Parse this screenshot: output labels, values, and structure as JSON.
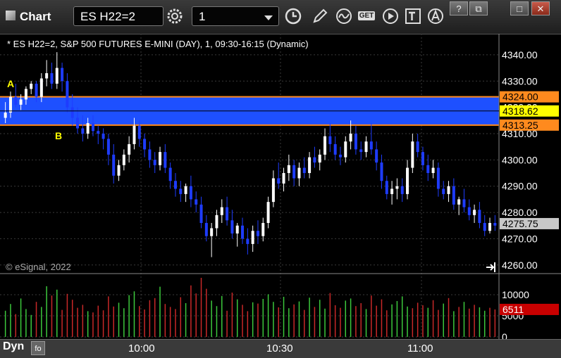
{
  "app": {
    "title": "Chart",
    "icon": "chart-window-icon"
  },
  "toolbar": {
    "symbol": "ES H22=2",
    "interval": "1",
    "buttons": [
      "settings-icon",
      "clock-icon",
      "pencil-icon",
      "wave-icon",
      "get-icon",
      "play-icon",
      "text-icon",
      "alert-icon"
    ],
    "get_label": "GET"
  },
  "window_buttons": {
    "help": "?",
    "restore": "⧉",
    "maximize": "□",
    "close": "✕"
  },
  "chart": {
    "title": "* ES H22=2, S&P 500 FUTURES E-MINI (DAY), 1, 09:30-16:15 (Dynamic)",
    "copyright": "© eSignal, 2022",
    "label_a": "A",
    "label_b": "B",
    "colors": {
      "up": "#ffffff",
      "down": "#1e3cff",
      "zone": "#1e50ff",
      "zone_line": "#ff8a1e",
      "last_price": "#c8c8c8",
      "mid_price": "#ffff00",
      "vol_up": "#3cc83c",
      "vol_down": "#c82828"
    }
  },
  "chart_data": {
    "type": "candlestick",
    "price_axis": {
      "ticks": [
        "4340.00",
        "4330.00",
        "4320.00",
        "4310.00",
        "4300.00",
        "4290.00",
        "4280.00",
        "4270.00",
        "4260.00"
      ],
      "range": [
        4257,
        4348
      ]
    },
    "price_labels": {
      "zone_top": "4324.00",
      "zone_mid": "4318.62",
      "zone_bottom": "4313.25",
      "last": "4275.75"
    },
    "zone": [
      4313.25,
      4324.0
    ],
    "volume_axis": {
      "ticks": [
        "10000",
        "5000",
        "0"
      ],
      "last_label": "6511",
      "range": [
        0,
        14500
      ]
    },
    "time_labels": [
      "10:00",
      "10:30",
      "11:00"
    ],
    "candles": [
      [
        4316,
        4322,
        4314,
        4318
      ],
      [
        4318,
        4326,
        4316,
        4324
      ],
      [
        4324,
        4329,
        4320,
        4321
      ],
      [
        4321,
        4325,
        4319,
        4323
      ],
      [
        4323,
        4328,
        4321,
        4327
      ],
      [
        4327,
        4330,
        4325,
        4329
      ],
      [
        4329,
        4330,
        4322,
        4324
      ],
      [
        4324,
        4333,
        4322,
        4331
      ],
      [
        4331,
        4338,
        4328,
        4333
      ],
      [
        4333,
        4337,
        4327,
        4329
      ],
      [
        4329,
        4341,
        4327,
        4335
      ],
      [
        4335,
        4337,
        4326,
        4330
      ],
      [
        4330,
        4333,
        4318,
        4320
      ],
      [
        4320,
        4325,
        4313,
        4316
      ],
      [
        4316,
        4320,
        4310,
        4312
      ],
      [
        4312,
        4317,
        4307,
        4310
      ],
      [
        4310,
        4316,
        4308,
        4314
      ],
      [
        4314,
        4317,
        4309,
        4311
      ],
      [
        4311,
        4313,
        4306,
        4310
      ],
      [
        4310,
        4312,
        4304,
        4308
      ],
      [
        4308,
        4310,
        4298,
        4302
      ],
      [
        4302,
        4306,
        4291,
        4294
      ],
      [
        4294,
        4300,
        4292,
        4298
      ],
      [
        4298,
        4304,
        4296,
        4302
      ],
      [
        4302,
        4309,
        4299,
        4306
      ],
      [
        4306,
        4316,
        4304,
        4313
      ],
      [
        4313,
        4315,
        4305,
        4308
      ],
      [
        4308,
        4310,
        4301,
        4304
      ],
      [
        4304,
        4307,
        4297,
        4300
      ],
      [
        4300,
        4303,
        4295,
        4298
      ],
      [
        4298,
        4305,
        4296,
        4303
      ],
      [
        4303,
        4306,
        4295,
        4297
      ],
      [
        4297,
        4299,
        4289,
        4292
      ],
      [
        4292,
        4295,
        4286,
        4289
      ],
      [
        4289,
        4292,
        4284,
        4287
      ],
      [
        4287,
        4291,
        4284,
        4290
      ],
      [
        4290,
        4294,
        4282,
        4285
      ],
      [
        4285,
        4288,
        4280,
        4283
      ],
      [
        4283,
        4286,
        4274,
        4276
      ],
      [
        4276,
        4279,
        4269,
        4271
      ],
      [
        4271,
        4276,
        4263,
        4274
      ],
      [
        4274,
        4281,
        4271,
        4279
      ],
      [
        4279,
        4285,
        4276,
        4282
      ],
      [
        4282,
        4286,
        4275,
        4277
      ],
      [
        4277,
        4281,
        4270,
        4272
      ],
      [
        4272,
        4276,
        4267,
        4275
      ],
      [
        4275,
        4278,
        4268,
        4270
      ],
      [
        4270,
        4274,
        4264,
        4268
      ],
      [
        4268,
        4275,
        4265,
        4273
      ],
      [
        4273,
        4277,
        4268,
        4271
      ],
      [
        4271,
        4278,
        4269,
        4276
      ],
      [
        4276,
        4286,
        4274,
        4284
      ],
      [
        4284,
        4296,
        4282,
        4293
      ],
      [
        4293,
        4299,
        4289,
        4291
      ],
      [
        4291,
        4297,
        4288,
        4295
      ],
      [
        4295,
        4302,
        4292,
        4298
      ],
      [
        4298,
        4300,
        4290,
        4293
      ],
      [
        4293,
        4299,
        4290,
        4297
      ],
      [
        4297,
        4301,
        4293,
        4295
      ],
      [
        4295,
        4303,
        4293,
        4301
      ],
      [
        4301,
        4305,
        4297,
        4299
      ],
      [
        4299,
        4304,
        4296,
        4302
      ],
      [
        4302,
        4312,
        4300,
        4309
      ],
      [
        4309,
        4314,
        4303,
        4306
      ],
      [
        4306,
        4309,
        4300,
        4302
      ],
      [
        4302,
        4305,
        4298,
        4301
      ],
      [
        4301,
        4309,
        4299,
        4307
      ],
      [
        4307,
        4315,
        4304,
        4310
      ],
      [
        4310,
        4313,
        4302,
        4304
      ],
      [
        4304,
        4307,
        4300,
        4303
      ],
      [
        4303,
        4309,
        4301,
        4307
      ],
      [
        4307,
        4314,
        4302,
        4304
      ],
      [
        4304,
        4307,
        4296,
        4299
      ],
      [
        4299,
        4302,
        4289,
        4292
      ],
      [
        4292,
        4294,
        4285,
        4287
      ],
      [
        4287,
        4292,
        4283,
        4289
      ],
      [
        4289,
        4293,
        4285,
        4290
      ],
      [
        4290,
        4293,
        4284,
        4287
      ],
      [
        4287,
        4300,
        4285,
        4297
      ],
      [
        4297,
        4310,
        4295,
        4307
      ],
      [
        4307,
        4310,
        4301,
        4303
      ],
      [
        4303,
        4305,
        4296,
        4298
      ],
      [
        4298,
        4302,
        4292,
        4295
      ],
      [
        4295,
        4300,
        4293,
        4297
      ],
      [
        4297,
        4299,
        4286,
        4289
      ],
      [
        4289,
        4292,
        4285,
        4287
      ],
      [
        4287,
        4292,
        4284,
        4290
      ],
      [
        4290,
        4293,
        4281,
        4283
      ],
      [
        4283,
        4286,
        4279,
        4285
      ],
      [
        4285,
        4289,
        4280,
        4282
      ],
      [
        4282,
        4285,
        4277,
        4279
      ],
      [
        4279,
        4283,
        4276,
        4281
      ],
      [
        4281,
        4284,
        4274,
        4276
      ],
      [
        4276,
        4279,
        4271,
        4273
      ],
      [
        4273,
        4278,
        4272,
        4276
      ],
      [
        4276,
        4279,
        4273,
        4275
      ]
    ],
    "volume": [
      6200,
      7800,
      5400,
      9100,
      6600,
      5200,
      8300,
      7100,
      12000,
      9800,
      11200,
      6400,
      10200,
      8800,
      6900,
      7600,
      6100,
      5800,
      7400,
      6300,
      9600,
      7200,
      8100,
      6800,
      9900,
      10800,
      7300,
      6500,
      8700,
      9200,
      11900,
      7800,
      7100,
      6600,
      9400,
      8000,
      12200,
      10300,
      14000,
      11400,
      8600,
      7300,
      9700,
      6200,
      10500,
      8900,
      7600,
      6100,
      8200,
      7900,
      9000,
      10100,
      8300,
      7000,
      9500,
      6800,
      7700,
      8400,
      6400,
      9300,
      7100,
      8800,
      6700,
      10400,
      7500,
      6900,
      8600,
      9100,
      7300,
      8000,
      6600,
      9800,
      7400,
      8900,
      6300,
      7700,
      8500,
      9600,
      7200,
      6800,
      8100,
      7500,
      6900,
      8700,
      6400,
      7900,
      9200,
      6100,
      7100,
      8300,
      6700,
      7600,
      7000,
      6200,
      6900,
      6511
    ],
    "volume_up": [
      true,
      true,
      false,
      true,
      true,
      true,
      false,
      true,
      true,
      false,
      true,
      false,
      false,
      false,
      false,
      false,
      true,
      false,
      false,
      false,
      false,
      false,
      true,
      true,
      true,
      true,
      false,
      false,
      false,
      false,
      true,
      false,
      false,
      false,
      false,
      true,
      false,
      false,
      false,
      false,
      true,
      true,
      true,
      false,
      false,
      true,
      false,
      false,
      true,
      false,
      true,
      true,
      true,
      false,
      true,
      true,
      false,
      true,
      false,
      true,
      false,
      true,
      true,
      false,
      false,
      false,
      true,
      true,
      false,
      false,
      true,
      false,
      false,
      false,
      false,
      true,
      true,
      true,
      true,
      false,
      false,
      false,
      true,
      false,
      false,
      true,
      false,
      true,
      false,
      true,
      false,
      false,
      true,
      true,
      false,
      false
    ]
  }
}
